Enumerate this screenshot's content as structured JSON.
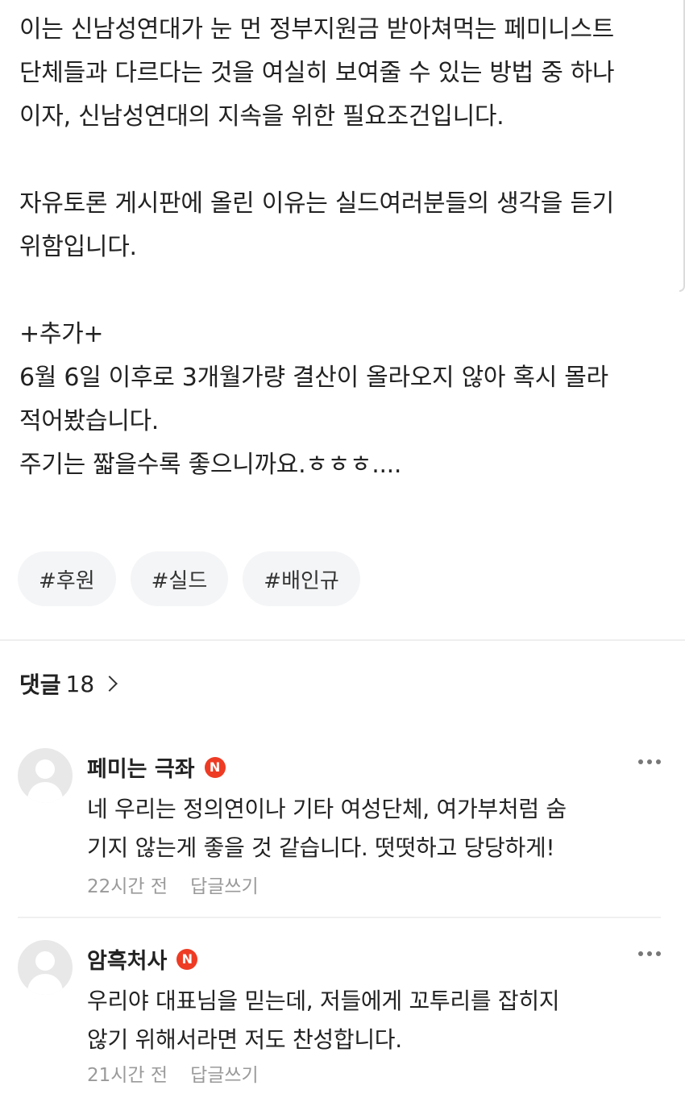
{
  "article": {
    "paragraph1": [
      "이는 신남성연대가 눈 먼 정부지원금 받아쳐먹는 페미니스트",
      "단체들과 다르다는 것을 여실히 보여줄 수 있는 방법 중 하나",
      "이자, 신남성연대의 지속을 위한 필요조건입니다."
    ],
    "paragraph2": [
      "자유토론 게시판에 올린 이유는 실드여러분들의 생각을 듣기",
      "위함입니다."
    ],
    "paragraph3": [
      "+추가+",
      "6월 6일 이후로 3개월가량 결산이 올라오지 않아 혹시 몰라",
      "적어봤습니다.",
      "주기는 짧을수록 좋으니까요.ㅎㅎㅎ...."
    ]
  },
  "tags": [
    "#후원",
    "#실드",
    "#배인규"
  ],
  "comments_header": {
    "title": "댓글",
    "count": "18"
  },
  "comments": [
    {
      "author": "페미는 극좌",
      "badge": "N",
      "lines": [
        "네 우리는 정의연이나 기타 여성단체, 여가부처럼 숨",
        "기지 않는게 좋을 것 같습니다. 떳떳하고 당당하게!"
      ],
      "time": "22시간 전",
      "reply_label": "답글쓰기"
    },
    {
      "author": "암흑처사",
      "badge": "N",
      "lines": [
        "우리야 대표님을 믿는데, 저들에게 꼬투리를 잡히지",
        "않기 위해서라면 저도 찬성합니다."
      ],
      "time": "21시간 전",
      "reply_label": "답글쓰기"
    }
  ],
  "colors": {
    "badge": "#ee3b24",
    "tag_bg": "#f4f5f7",
    "meta_text": "#9a9a9a"
  },
  "icons": [
    "chevron-right-icon",
    "more-icon",
    "avatar-placeholder-icon"
  ]
}
